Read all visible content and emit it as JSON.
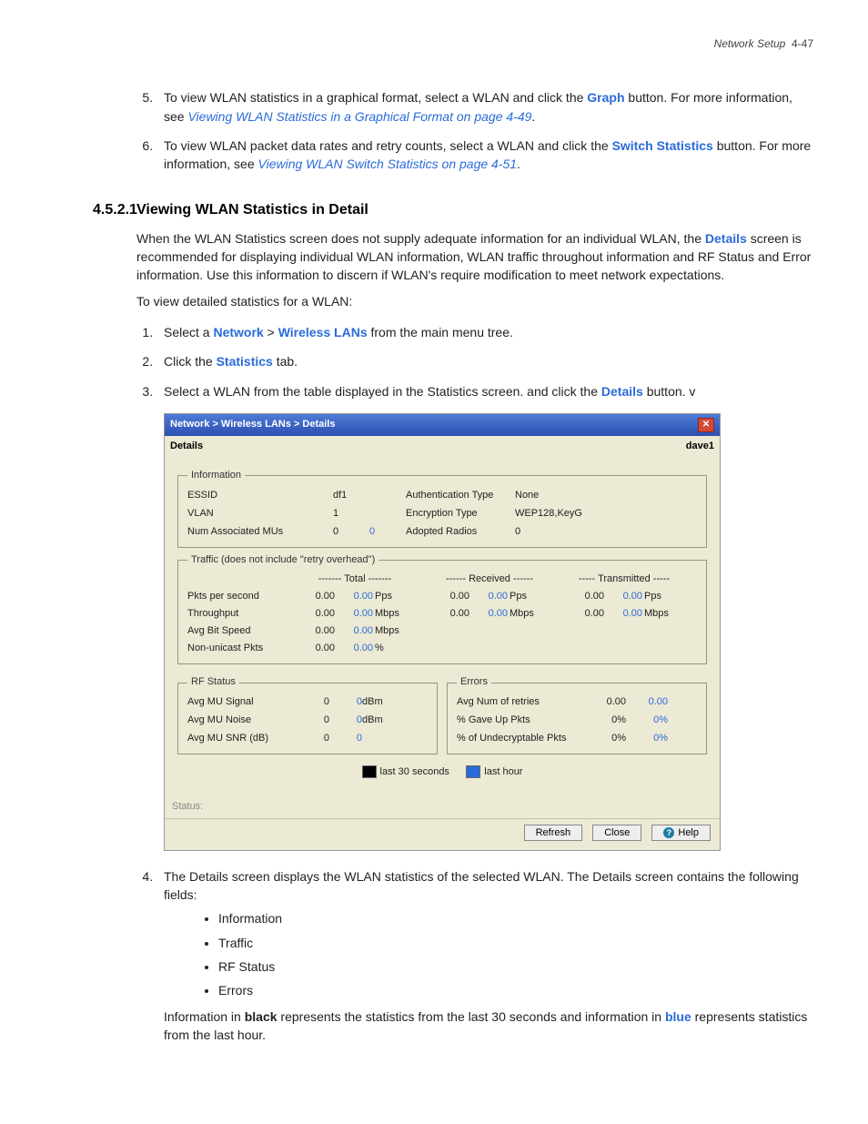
{
  "page_header": {
    "section": "Network Setup",
    "page": "4-47"
  },
  "step5": {
    "t1": "To view WLAN statistics in a graphical format, select a WLAN and click the ",
    "btn": "Graph",
    "t2": " button. For more information, see ",
    "link": "Viewing WLAN Statistics in a Graphical Format on page 4-49",
    "t3": "."
  },
  "step6": {
    "t1": "To view WLAN packet data rates and retry counts, select a WLAN and click the ",
    "btn": "Switch Statistics",
    "t2": " button. For more information, see ",
    "link": "Viewing WLAN Switch Statistics on page 4-51",
    "t3": "."
  },
  "section_no": "4.5.2.1",
  "section_title": "Viewing WLAN Statistics in Detail",
  "intro1a": "When the WLAN Statistics screen does not supply adequate information for an individual WLAN, the ",
  "intro_details": "Details",
  "intro1b": " screen is recommended for displaying individual WLAN information, WLAN traffic throughout information and RF Status and Error information. Use this information to discern if WLAN's require modification to meet network expectations.",
  "intro2": "To view detailed statistics for a WLAN:",
  "sub1": {
    "a": "Select a ",
    "b": "Network",
    "gt": " > ",
    "c": "Wireless LANs",
    "d": " from the main menu tree."
  },
  "sub2": {
    "a": "Click the ",
    "b": "Statistics",
    "c": " tab."
  },
  "sub3": {
    "a": "Select a WLAN from the table displayed in the Statistics screen. and click the ",
    "b": "Details",
    "c": " button. v"
  },
  "shot": {
    "breadcrumb": "Network > Wireless LANs > Details",
    "details_label": "Details",
    "user": "dave1",
    "info_legend": "Information",
    "info": {
      "essid_l": "ESSID",
      "essid": "df1",
      "vlan_l": "VLAN",
      "vlan": "1",
      "num_l": "Num Associated MUs",
      "num": "0",
      "num2": "0",
      "auth_l": "Authentication Type",
      "auth": "None",
      "enc_l": "Encryption Type",
      "enc": "WEP128,KeyG",
      "rad_l": "Adopted Radios",
      "rad": "0"
    },
    "traffic_legend": "Traffic (does not include \"retry overhead\")",
    "traffic_headers": {
      "total": "------- Total -------",
      "recv": "------ Received ------",
      "tx": "----- Transmitted -----"
    },
    "traffic_rows": [
      {
        "label": "Pkts per second",
        "t": "0.00",
        "t2": "0.00",
        "tu": "Pps",
        "r": "0.00",
        "r2": "0.00",
        "ru": "Pps",
        "x": "0.00",
        "x2": "0.00",
        "xu": "Pps"
      },
      {
        "label": "Throughput",
        "t": "0.00",
        "t2": "0.00",
        "tu": "Mbps",
        "r": "0.00",
        "r2": "0.00",
        "ru": "Mbps",
        "x": "0.00",
        "x2": "0.00",
        "xu": "Mbps"
      },
      {
        "label": "Avg Bit Speed",
        "t": "0.00",
        "t2": "0.00",
        "tu": "Mbps",
        "r": "",
        "r2": "",
        "ru": "",
        "x": "",
        "x2": "",
        "xu": ""
      },
      {
        "label": "Non-unicast Pkts",
        "t": "0.00",
        "t2": "0.00",
        "tu": "%",
        "r": "",
        "r2": "",
        "ru": "",
        "x": "",
        "x2": "",
        "xu": ""
      }
    ],
    "rf_legend": "RF Status",
    "rf_rows": [
      {
        "label": "Avg MU Signal",
        "v": "0",
        "v2": "0",
        "u": "dBm"
      },
      {
        "label": "Avg MU Noise",
        "v": "0",
        "v2": "0",
        "u": "dBm"
      },
      {
        "label": "Avg MU SNR (dB)",
        "v": "0",
        "v2": "0",
        "u": ""
      }
    ],
    "err_legend": "Errors",
    "err_rows": [
      {
        "label": "Avg Num of retries",
        "v": "0.00",
        "v2": "0.00"
      },
      {
        "label": "% Gave Up Pkts",
        "v": "0%",
        "v2": "0%"
      },
      {
        "label": "% of Undecryptable Pkts",
        "v": "0%",
        "v2": "0%"
      }
    ],
    "legend": {
      "l30": "last 30 seconds",
      "lhr": "last hour"
    },
    "status": "Status:",
    "btns": {
      "refresh": "Refresh",
      "close": "Close",
      "help": "Help"
    }
  },
  "step4": {
    "t": "The Details screen displays the WLAN statistics of the selected WLAN. The Details screen contains the following fields:",
    "b1": "Information",
    "b2": "Traffic",
    "b3": "RF Status",
    "b4": "Errors"
  },
  "outro": {
    "a": "Information in ",
    "b": "black",
    "c": " represents the statistics from the last 30 seconds and information in ",
    "d": "blue",
    "e": " represents statistics from the last hour."
  }
}
